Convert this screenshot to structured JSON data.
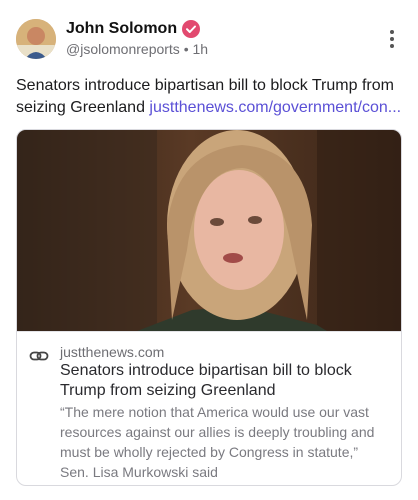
{
  "author": {
    "name": "John Solomon",
    "handle": "@jsolomonreports",
    "separator": "•",
    "time": "1h"
  },
  "post": {
    "text": "Senators introduce bipartisan bill to block Trump from seizing Greenland ",
    "link_text": "justthenews.com/government/con..."
  },
  "card": {
    "domain": "justthenews.com",
    "title": "Senators introduce bipartisan bill to block Trump from seizing Greenland",
    "description": "“The mere notion that America would use our vast resources against our allies is deeply troubling and must be wholly rejected by Congress in statute,” Sen. Lisa Murkowski said"
  },
  "colors": {
    "link": "#5b50d6",
    "verified_badge": "#e2496f"
  },
  "icons": {
    "verified": "verified-badge-icon",
    "menu": "more-vertical-icon",
    "link": "link-icon"
  }
}
